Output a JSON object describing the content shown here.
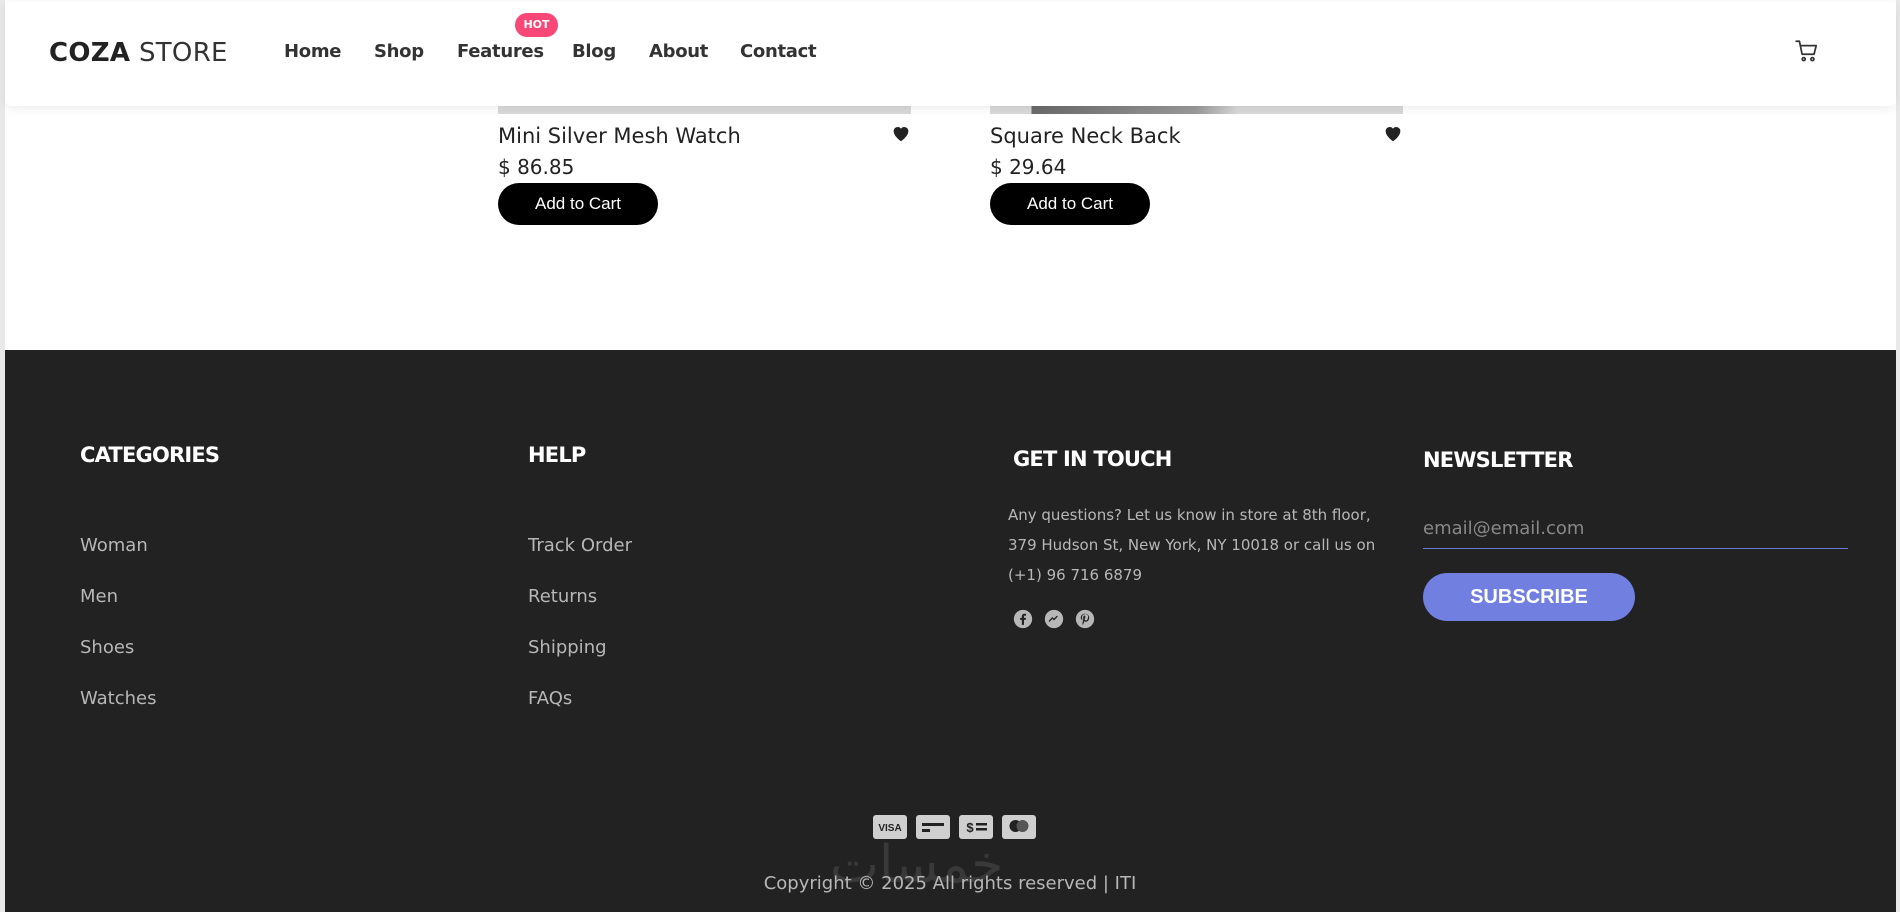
{
  "header": {
    "logo_bold": "COZA",
    "logo_light": "STORE",
    "nav": [
      "Home",
      "Shop",
      "Features",
      "Blog",
      "About",
      "Contact"
    ],
    "hot_badge": "HOT",
    "cart_icon": "shopping-cart-icon"
  },
  "products": [
    {
      "name": "Mini Silver Mesh Watch",
      "price": "$ 86.85",
      "button": "Add to Cart",
      "icon": "heart-icon"
    },
    {
      "name": "Square Neck Back",
      "price": "$ 29.64",
      "button": "Add to Cart",
      "icon": "heart-icon"
    }
  ],
  "footer": {
    "categories": {
      "title": "CATEGORIES",
      "items": [
        "Woman",
        "Men",
        "Shoes",
        "Watches"
      ]
    },
    "help": {
      "title": "HELP",
      "items": [
        "Track Order",
        "Returns",
        "Shipping",
        "FAQs"
      ]
    },
    "contact": {
      "title": "GET IN TOUCH",
      "text": "Any questions? Let us know in store at 8th floor, 379 Hudson St, New York, NY 10018 or call us on (+1) 96 716 6879",
      "social_icons": [
        "facebook-icon",
        "messenger-icon",
        "pinterest-icon"
      ]
    },
    "newsletter": {
      "title": "NEWSLETTER",
      "placeholder": "email@email.com",
      "button": "SUBSCRIBE"
    },
    "payment_icons": [
      "visa-icon",
      "card-icon",
      "cash-icon",
      "mastercard-icon"
    ],
    "watermark": "خمسات",
    "copyright": "Copyright © 2025 All rights reserved | ITI"
  },
  "colors": {
    "footer_bg": "#222222",
    "accent": "#717fe0",
    "hot_badge": "#f74877"
  }
}
